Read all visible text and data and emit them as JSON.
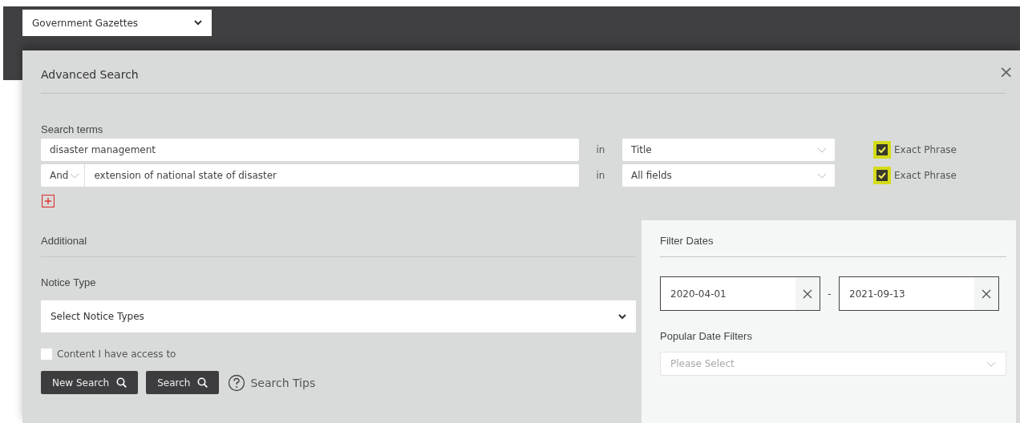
{
  "collection_select": {
    "value": "Government Gazettes"
  },
  "dialog": {
    "title": "Advanced Search",
    "close": "×"
  },
  "search_terms": {
    "label": "Search terms",
    "rows": [
      {
        "operator": null,
        "term": "disaster management",
        "in_label": "in",
        "field": "Title",
        "exact_phrase": {
          "label": "Exact Phrase",
          "checked": true,
          "highlighted": true
        }
      },
      {
        "operator": "And",
        "term": "extension of national state of disaster",
        "in_label": "in",
        "field": "All fields",
        "exact_phrase": {
          "label": "Exact Phrase",
          "checked": true,
          "highlighted": true
        }
      }
    ]
  },
  "additional": {
    "title": "Additional",
    "notice_type_label": "Notice Type",
    "notice_type_select": "Select Notice Types",
    "access_checkbox": {
      "label": "Content I have access to",
      "checked": false
    }
  },
  "buttons": [
    {
      "label": "New Search"
    },
    {
      "label": "Search"
    }
  ],
  "search_tips": "Search Tips",
  "filter_dates": {
    "title": "Filter Dates",
    "from": "2020-04-01",
    "separator": "-",
    "to": "2021-09-13",
    "popular_label": "Popular Date Filters",
    "popular_placeholder": "Please Select"
  }
}
